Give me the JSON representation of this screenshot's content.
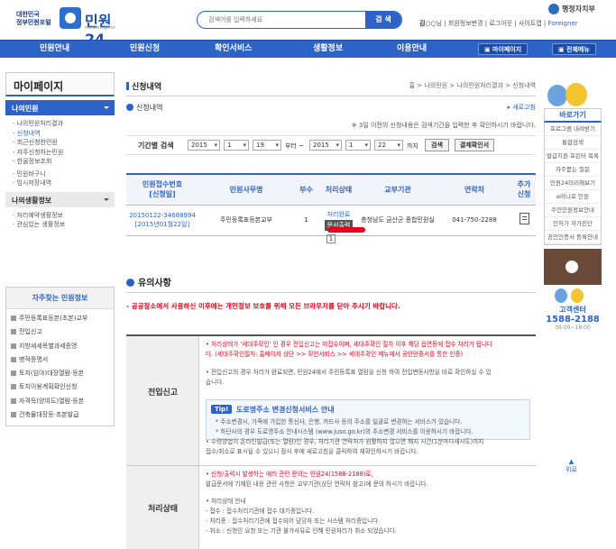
{
  "header": {
    "gov_line1": "대한민국",
    "gov_line2": "정부민원포털",
    "logo_text": "민원24",
    "logo_sub": "minwon.go.kr",
    "search_placeholder": "검색어를 입력하세요",
    "search_button": "검 색",
    "user_name": "김○○",
    "user_suffix": "님 | 회원정보변경 | 로그아웃 | 사이트맵 |",
    "foreigner": "Foreigner",
    "ministry": "행정자치부"
  },
  "nav": {
    "items": [
      "민원안내",
      "민원신청",
      "확인서비스",
      "생활정보",
      "이용안내"
    ],
    "my_page": "▣ 마이페이지",
    "all_menu": "▣ 전체메뉴"
  },
  "lnb": {
    "title": "마이페이지",
    "selected": "나의민원",
    "sub_items": [
      "· 나의민원처리결과",
      "- 신청내역",
      "- 최근신청한민원",
      "- 자주신청하는민원",
      "- 한울정보조회",
      "· 민원바구니",
      "· 임시저장내역"
    ],
    "group2": "나의생활정보",
    "group2_items": [
      "· 처리예약생활정보",
      "· 관심있는 생활정보"
    ]
  },
  "favorites": {
    "title": "자주찾는 민원정보",
    "items": [
      "주민등록표등본(초본)교부",
      "전입신고",
      "지방세세목별과세증명",
      "병적증명서",
      "토지(임야)대장열람·등본",
      "토지이용계획확인신청",
      "자격득(양여도)열람·등본",
      "건축물대장등·초본발급"
    ]
  },
  "main": {
    "title": "신청내역",
    "breadcrumb": "홈 > 나의민원 > 나의민원처리결과 > 신청내역",
    "subtitle": "신청내역",
    "new_link": "▸ 새로고침",
    "note": "※ 3일 이전의 신청내용은 검색기간을 입력한 후 확인하시기 바랍니다.",
    "period": {
      "label": "기간별 검색",
      "from_year": "2015",
      "from_month": "1",
      "from_day": "19",
      "from_text": "부터 ~",
      "to_year": "2015",
      "to_month": "1",
      "to_day": "22",
      "to_text": "까지",
      "search_btn": "검색",
      "print_btn": "결제확인서"
    }
  },
  "table": {
    "headers": [
      "민원접수번호\n[신청일]",
      "민원사무명",
      "부수",
      "처리상태",
      "교부기관",
      "연락처",
      "추가\n신청"
    ],
    "row": {
      "receipt": "20150122-34688994",
      "receipt_date": "[2015년01월22일]",
      "name": "주민등록표등본교부",
      "count": "1",
      "status": "처리완료",
      "status_btn": "문서출력",
      "agency": "충청남도 금산군 종합민원실",
      "contact": "041-750-2288"
    },
    "page": "1"
  },
  "caution": {
    "title": "유의사항",
    "warning": "- 공공장소에서 사용하신 이후에는 개인정보 보호를 위해 모든 브라우저를 닫아 주시기 바랍니다.",
    "row1_label": "전입신고",
    "row1_red1": "• 처리상태가 '세대주확인' 인 경우 전입신고는 미접수이며, 세대주확인 절차 이후 해당 읍면동에 접수 처리가 됩니다",
    "row1_red2": "다. (세대주확인절차: 홈페이지 상단 >> 확인서비스 >> 세대주확인 메뉴에서 공인인증서를 통한 인증)",
    "row1_gray1": "• 전입신고의 경우 처리가 완료되면, 민원24에서 주민등록표 열람을 신청 하여 전입변동사항을 바로 확인하실 수 있",
    "row1_gray2": "습니다.",
    "tip_badge": "Tip!",
    "tip_title": "도로명주소 변경신청서비스 안내",
    "tip_line1": "* 주소변경시, 가족에 가입한 통신사, 은행, 카드사 등의 주소를 일괄로 변경하는 서비스가 있습니다.",
    "tip_line2": "* 하단사의 경우 도로명주소 안내시스템 (www.juso.go.kr)의 주소변경 서비스를 이용하시기 바랍니다.",
    "row2_label": "처리상태",
    "row2_g1": "• 수령방법이 온라인발급(또는 열람)인 경우, 처리기관 연락처가 원활하지 않으면 해지 시간(1분마다새시도)까지",
    "row2_g2": "접수/취소로 표시될 수 있으니 잠시 후에 새로고침을 클릭하여 재확인하시기 바랍니다.",
    "row2_red": "• 신청/출력시 발생하는 에러 관련 문의는 민원24(1588-2188)로,",
    "row2_g3": "발급문서에 기재된 내용 관련 사항은 교부기관(상단 연락처 참고)에 문의 하시기 바랍니다.",
    "row2_g4": "• 처리상태 안내",
    "row2_g5": "- 접수 : 접수처리기관에 접수 대기중입니다.",
    "row2_g6": "- 처리중 : 접수처리기관에 접수되어 담당자 또는 시스템 처리중입니다.",
    "row2_g7": "- 취소 : 신청인 요청 또는 기관 불가사유로 인해 민원처리가 취소 되었습니다."
  },
  "quick": {
    "title": "바로가기",
    "items": [
      "프로그램 내려받기",
      "통합검색",
      "발급지원 프린터 목록",
      "자주묻는 질문",
      "민원24미리해보기",
      "e러니로 민원",
      "주민민원정보안내",
      "인허가 자가진단",
      "공인인증서 등록안내"
    ],
    "cc_label": "고객센터",
    "cc_phone": "1588-2188",
    "cc_hours": "09:00~18:00"
  },
  "to_top": "위로"
}
